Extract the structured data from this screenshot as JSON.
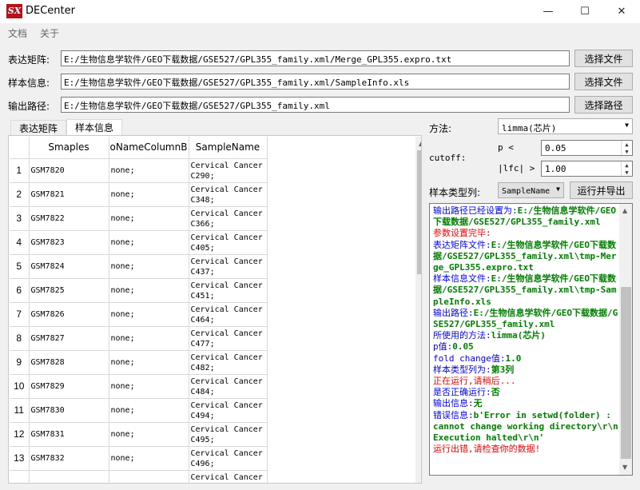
{
  "window": {
    "app_icon_text": "SX",
    "title": "DECenter",
    "minimize": "—",
    "maximize": "☐",
    "close": "✕"
  },
  "menu": {
    "items": [
      "文档",
      "关于"
    ]
  },
  "inputs": {
    "expr": {
      "label": "表达矩阵:",
      "value": "E:/生物信息学软件/GEO下载数据/GSE527/GPL355_family.xml/Merge_GPL355.expro.txt",
      "button": "选择文件"
    },
    "sample": {
      "label": "样本信息:",
      "value": "E:/生物信息学软件/GEO下载数据/GSE527/GPL355_family.xml/SampleInfo.xls",
      "button": "选择文件"
    },
    "output": {
      "label": "输出路径:",
      "value": "E:/生物信息学软件/GEO下载数据/GSE527/GPL355_family.xml",
      "button": "选择路径"
    }
  },
  "tabs": [
    "表达矩阵",
    "样本信息"
  ],
  "table": {
    "headers": [
      "Smaples",
      "oNameColumnB",
      "SampleName"
    ],
    "rows": [
      {
        "n": "1",
        "s": "GSM7820",
        "b": "none;",
        "name": "Cervical Cancer C290;"
      },
      {
        "n": "2",
        "s": "GSM7821",
        "b": "none;",
        "name": "Cervical Cancer C348;"
      },
      {
        "n": "3",
        "s": "GSM7822",
        "b": "none;",
        "name": "Cervical Cancer C366;"
      },
      {
        "n": "4",
        "s": "GSM7823",
        "b": "none;",
        "name": "Cervical Cancer C405;"
      },
      {
        "n": "5",
        "s": "GSM7824",
        "b": "none;",
        "name": "Cervical Cancer C437;"
      },
      {
        "n": "6",
        "s": "GSM7825",
        "b": "none;",
        "name": "Cervical Cancer C451;"
      },
      {
        "n": "7",
        "s": "GSM7826",
        "b": "none;",
        "name": "Cervical Cancer C464;"
      },
      {
        "n": "8",
        "s": "GSM7827",
        "b": "none;",
        "name": "Cervical Cancer C477;"
      },
      {
        "n": "9",
        "s": "GSM7828",
        "b": "none;",
        "name": "Cervical Cancer C482;"
      },
      {
        "n": "10",
        "s": "GSM7829",
        "b": "none;",
        "name": "Cervical Cancer C484;"
      },
      {
        "n": "11",
        "s": "GSM7830",
        "b": "none;",
        "name": "Cervical Cancer C494;"
      },
      {
        "n": "12",
        "s": "GSM7831",
        "b": "none;",
        "name": "Cervical Cancer C495;"
      },
      {
        "n": "13",
        "s": "GSM7832",
        "b": "none;",
        "name": "Cervical Cancer C496;"
      },
      {
        "n": "",
        "s": "",
        "b": "",
        "name": "Cervical Cancer"
      }
    ]
  },
  "params": {
    "method_label": "方法:",
    "method_value": "limma(芯片)",
    "cutoff_label": "cutoff:",
    "p_label": "p <",
    "p_value": "0.05",
    "lfc_label": "|lfc| >",
    "lfc_value": "1.00",
    "sample_type_label": "样本类型列:",
    "sample_type_value": "SampleName",
    "run_button": "运行并导出"
  },
  "log": [
    {
      "c": "blue",
      "t": "输出路径已经设置为:"
    },
    {
      "c": "green",
      "t": "E:/生物信息学软件/GEO下载数据/GSE527/GPL355_family.xml"
    },
    {
      "c": "red",
      "t": "参数设置完毕:"
    },
    {
      "c": "blue",
      "t": "表达矩阵文件:"
    },
    {
      "c": "green",
      "t": "E:/生物信息学软件/GEO下载数据/GSE527/GPL355_family.xml\\tmp-Merge_GPL355.expro.txt"
    },
    {
      "c": "blue",
      "t": "样本信息文件:"
    },
    {
      "c": "green",
      "t": "E:/生物信息学软件/GEO下载数据/GSE527/GPL355_family.xml\\tmp-SampleInfo.xls"
    },
    {
      "c": "blue",
      "t": "输出路径:"
    },
    {
      "c": "green",
      "t": "E:/生物信息学软件/GEO下载数据/GSE527/GPL355_family.xml"
    },
    {
      "c": "blue",
      "t": "所使用的方法:"
    },
    {
      "c": "green",
      "t": "limma(芯片)"
    },
    {
      "c": "blue",
      "t": "p值:"
    },
    {
      "c": "green",
      "t": "0.05"
    },
    {
      "c": "blue",
      "t": "fold change值:"
    },
    {
      "c": "green",
      "t": "1.0"
    },
    {
      "c": "blue",
      "t": "样本类型列为:"
    },
    {
      "c": "green",
      "t": "第3列"
    },
    {
      "c": "red",
      "t": "正在运行,请稍后..."
    },
    {
      "c": "blue",
      "t": "是否正确运行:"
    },
    {
      "c": "green",
      "t": "否"
    },
    {
      "c": "blue",
      "t": "输出信息:"
    },
    {
      "c": "green",
      "t": "无"
    },
    {
      "c": "blue",
      "t": "错误信息:"
    },
    {
      "c": "green",
      "t": "b'Error in setwd(folder) : cannot change working directory\\r\\nExecution halted\\r\\n'"
    },
    {
      "c": "red",
      "t": "运行出错,请检查你的数据!"
    }
  ],
  "colors": {
    "log_blue": "#0000ff",
    "log_green": "#008000",
    "log_red": "#ff0000",
    "icon_red": "#b5121b"
  }
}
